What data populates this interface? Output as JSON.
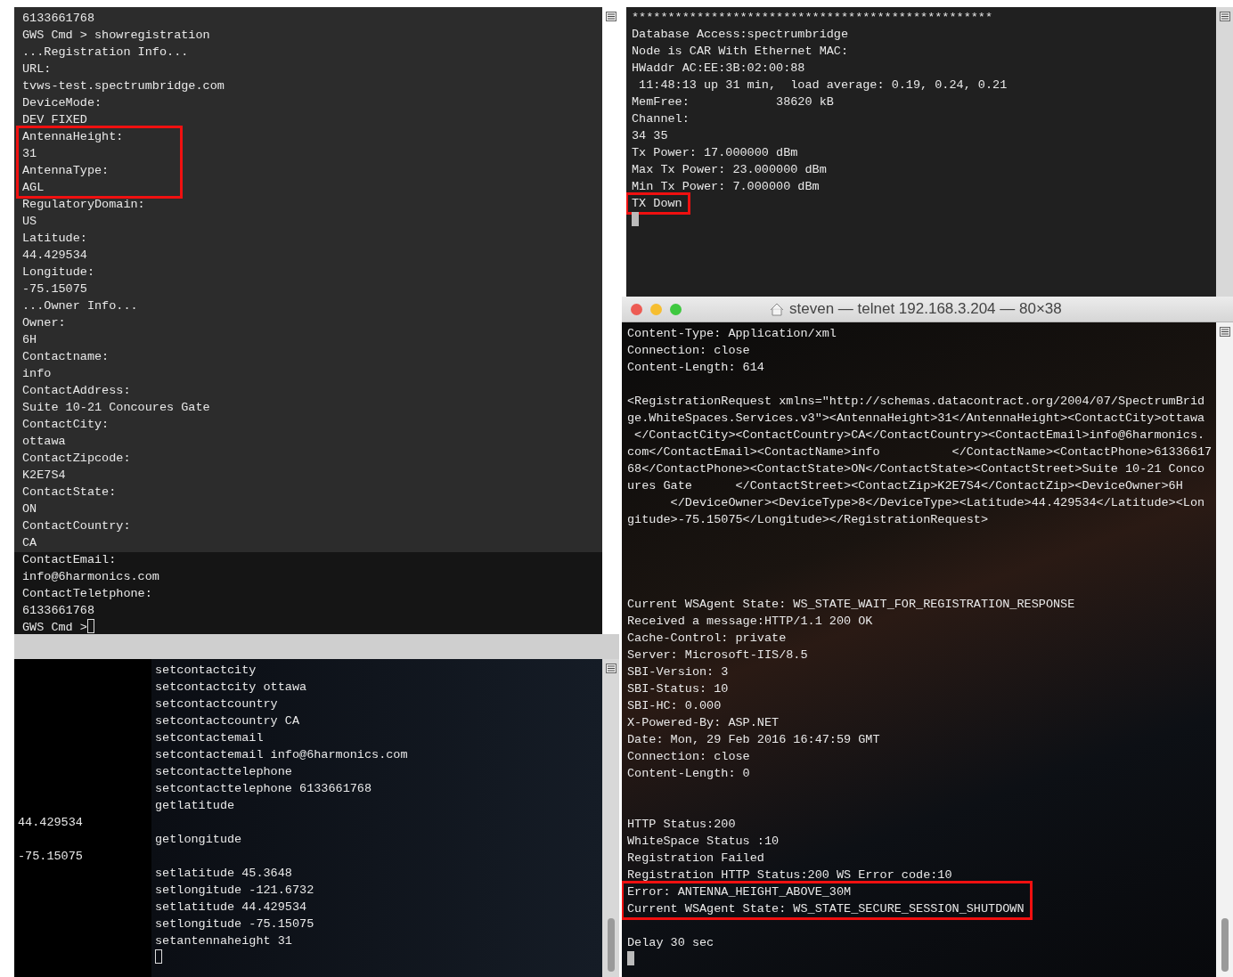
{
  "terminals": [
    {
      "kind": "translucent",
      "blocks": [
        {
          "kind": "output",
          "highlighted": false,
          "lines": [
            "6133661768",
            "GWS Cmd > showregistration",
            "...Registration Info...",
            "URL:",
            "tvws-test.spectrumbridge.com",
            "DeviceMode:",
            "DEV FIXED"
          ]
        },
        {
          "kind": "output",
          "highlighted": true,
          "lines": [
            "AntennaHeight:",
            "31",
            "AntennaType:",
            "AGL"
          ]
        },
        {
          "kind": "output",
          "highlighted": false,
          "lines": [
            "RegulatoryDomain:",
            "US",
            "Latitude:",
            "44.429534",
            "Longitude:",
            "-75.15075",
            "...Owner Info...",
            "Owner:",
            "6H",
            "Contactname:",
            "info",
            "ContactAddress:",
            "Suite 10-21 Concoures Gate",
            "ContactCity:",
            "ottawa",
            "ContactZipcode:",
            "K2E7S4",
            "ContactState:",
            "ON",
            "ContactCountry:",
            "CA",
            "ContactEmail:",
            "info@6harmonics.com",
            "ContactTeletphone:",
            "6133661768"
          ]
        }
      ],
      "prompt": "GWS Cmd >",
      "cursor": true
    },
    {
      "kind": "solid",
      "blocks": [
        {
          "kind": "command",
          "highlighted": false,
          "lines": [
            "setcontactcity",
            "setcontactcity ottawa",
            "setcontactcountry",
            "setcontactcountry CA",
            "setcontactemail",
            "setcontactemail info@6harmonics.com",
            "setcontacttelephone",
            "setcontacttelephone 6133661768",
            "getlatitude"
          ]
        },
        {
          "kind": "output",
          "highlighted": false,
          "lines": [
            "44.429534"
          ]
        },
        {
          "kind": "command",
          "highlighted": false,
          "lines": [
            "getlongitude"
          ]
        },
        {
          "kind": "output",
          "highlighted": false,
          "lines": [
            "-75.15075"
          ]
        },
        {
          "kind": "command",
          "highlighted": false,
          "lines": [
            "setlatitude 45.3648",
            "setlongitude -121.6732",
            "setlatitude 44.429534",
            "setlongitude -75.15075",
            "setantennaheight 31"
          ]
        }
      ],
      "cursor": true
    },
    {
      "kind": "translucent",
      "blocks": [
        {
          "kind": "output",
          "highlighted": false,
          "lines": [
            "**************************************************",
            "Database Access:spectrumbridge",
            "Node is CAR With Ethernet MAC:",
            "HWaddr AC:EE:3B:02:00:88",
            " 11:48:13 up 31 min,  load average: 0.19, 0.24, 0.21",
            "MemFree:            38620 kB",
            "Channel:",
            "34 35",
            "Tx Power: 17.000000 dBm",
            "Max Tx Power: 23.000000 dBm",
            "Min Tx Power: 7.000000 dBm"
          ]
        },
        {
          "kind": "output",
          "highlighted": true,
          "lines": [
            "TX Down"
          ]
        }
      ],
      "cursor": true
    },
    {
      "kind": "window",
      "title": "steven — telnet 192.168.3.204 — 80×38",
      "blocks": [
        {
          "kind": "output",
          "highlighted": false,
          "lines": [
            "Content-Type: Application/xml",
            "Connection: close",
            "Content-Length: 614"
          ]
        },
        {
          "kind": "output",
          "highlighted": false,
          "lines": [
            "<RegistrationRequest xmlns=\"http://schemas.datacontract.org/2004/07/SpectrumBrid",
            "ge.WhiteSpaces.Services.v3\"><AntennaHeight>31</AntennaHeight><ContactCity>ottawa",
            " </ContactCity><ContactCountry>CA</ContactCountry><ContactEmail>info@6harmonics.",
            "com</ContactEmail><ContactName>info          </ContactName><ContactPhone>61336617",
            "68</ContactPhone><ContactState>ON</ContactState><ContactStreet>Suite 10-21 Conco",
            "ures Gate      </ContactStreet><ContactZip>K2E7S4</ContactZip><DeviceOwner>6H",
            "      </DeviceOwner><DeviceType>8</DeviceType><Latitude>44.429534</Latitude><Lon",
            "gitude>-75.15075</Longitude></RegistrationRequest>"
          ]
        },
        {
          "kind": "output",
          "highlighted": false,
          "lines": [
            "Current WSAgent State: WS_STATE_WAIT_FOR_REGISTRATION_RESPONSE",
            "Received a message:HTTP/1.1 200 OK",
            "Cache-Control: private",
            "Server: Microsoft-IIS/8.5",
            "SBI-Version: 3",
            "SBI-Status: 10",
            "SBI-HC: 0.000",
            "X-Powered-By: ASP.NET",
            "Date: Mon, 29 Feb 2016 16:47:59 GMT",
            "Connection: close",
            "Content-Length: 0"
          ]
        },
        {
          "kind": "output",
          "highlighted": false,
          "lines": [
            "HTTP Status:200",
            "WhiteSpace Status :10",
            "Registration Failed",
            "Registration HTTP Status:200 WS Error code:10"
          ]
        },
        {
          "kind": "output",
          "highlighted": true,
          "lines": [
            "Error: ANTENNA_HEIGHT_ABOVE_30M",
            "Current WSAgent State: WS_STATE_SECURE_SESSION_SHUTDOWN"
          ]
        },
        {
          "kind": "output",
          "highlighted": false,
          "lines": [
            "Delay 30 sec"
          ]
        }
      ],
      "cursor": true
    }
  ]
}
